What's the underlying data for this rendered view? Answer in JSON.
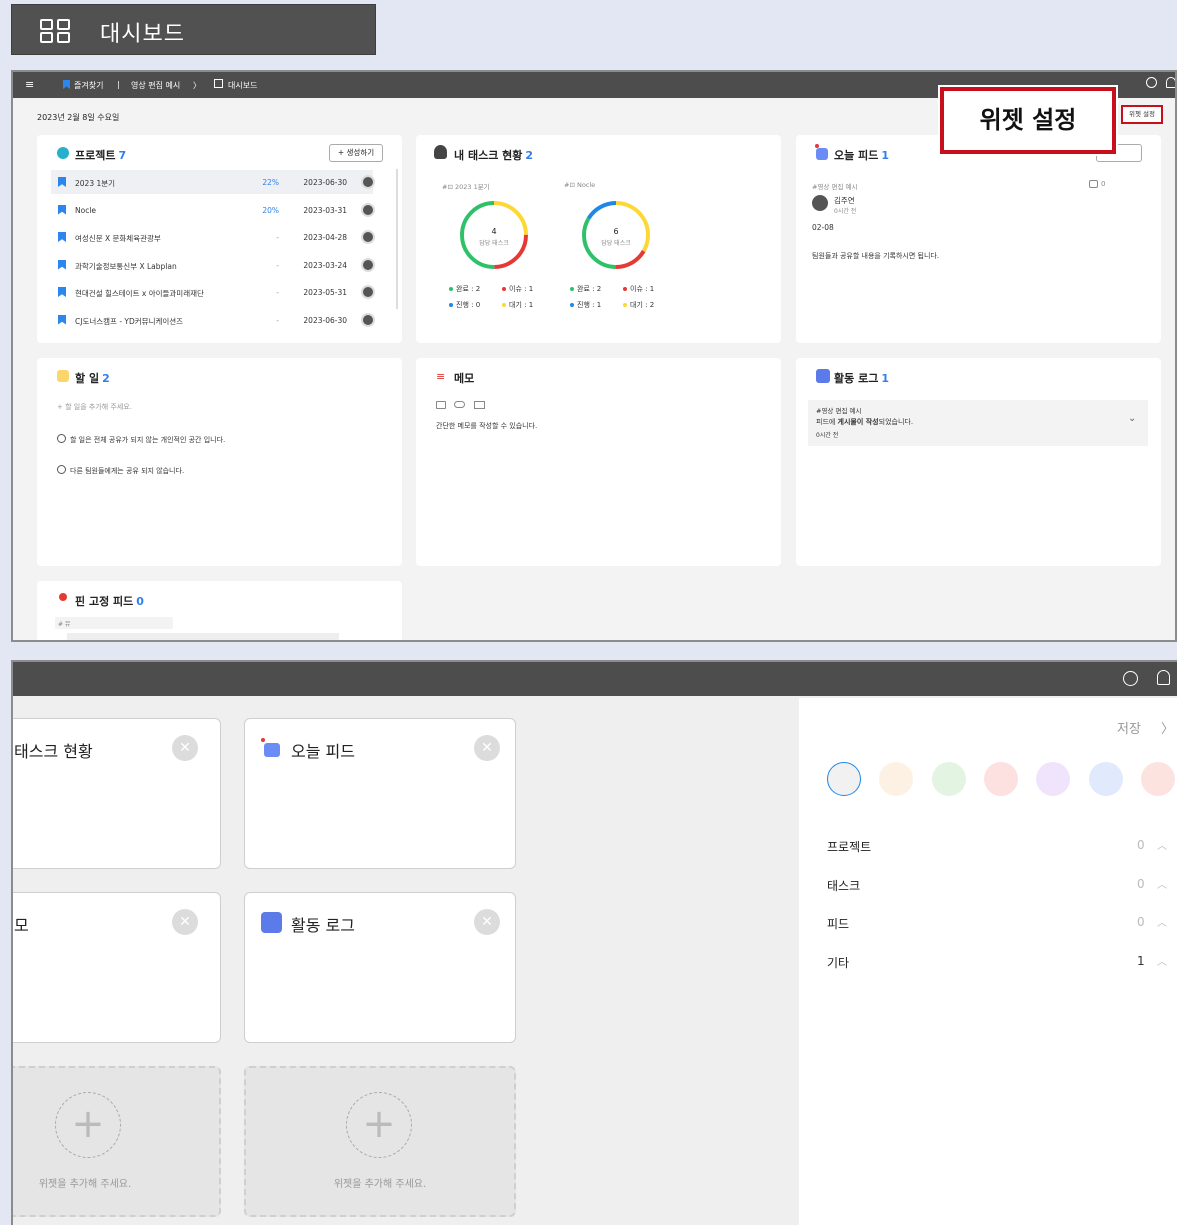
{
  "header": {
    "title": "대시보드",
    "icon": "dashboard-grid-icon"
  },
  "shot1": {
    "nav": {
      "favorites": "즐겨찾기",
      "divider": "|",
      "project": "영상 편집 예시",
      "arrow": "〉",
      "page": "대시보드"
    },
    "date": "2023년 2월 8일 수요일",
    "widget_settings_btn": "위젯 설정",
    "projects": {
      "title": "프로젝트",
      "count": "7",
      "create_btn": "+ 생성하기",
      "rows": [
        {
          "name": "2023 1분기",
          "pct": "22%",
          "date": "2023-06-30"
        },
        {
          "name": "Nocle",
          "pct": "20%",
          "date": "2023-03-31"
        },
        {
          "name": "여성신문 X 문화체육관광부",
          "pct": "-",
          "date": "2023-04-28"
        },
        {
          "name": "과학기술정보통신부 X Labplan",
          "pct": "-",
          "date": "2023-03-24"
        },
        {
          "name": "현대건설 힐스테이트 x 아이들과미래재단",
          "pct": "-",
          "date": "2023-05-31"
        },
        {
          "name": "CJ도너스캠프 - YD커뮤니케이션즈",
          "pct": "-",
          "date": "2023-06-30"
        }
      ]
    },
    "tasks": {
      "title": "내 태스크 현황",
      "count": "2",
      "charts": [
        {
          "tag": "#⊡ 2023 1분기",
          "num": "4",
          "label": "담당 태스크",
          "done": "완료 : 2",
          "issue": "이슈 : 1",
          "prog": "진행 : 0",
          "wait": "대기 : 1"
        },
        {
          "tag": "#⊡ Nocle",
          "num": "6",
          "label": "담당 태스크",
          "done": "완료 : 2",
          "issue": "이슈 : 1",
          "prog": "진행 : 1",
          "wait": "대기 : 2"
        }
      ]
    },
    "feed": {
      "title": "오늘 피드",
      "count": "1",
      "tag": "#영상 편집 예시",
      "user": "김주연",
      "time": "0시간 전",
      "date": "02-08",
      "img_count": "0",
      "body": "팀원들과 공유할 내용을 기록하시면 됩니다."
    },
    "todo": {
      "title": "할 일",
      "count": "2",
      "placeholder": "+ 할 일을 추가해 주세요.",
      "items": [
        "할 일은 전체 공유가 되지 않는 개인적인 공간 입니다.",
        "다른 팀원들에게는 공유 되지 않습니다."
      ]
    },
    "memo": {
      "title": "메모",
      "body": "간단한 메모를 작성할 수 있습니다."
    },
    "activity": {
      "title": "활동 로그",
      "count": "1",
      "tag": "#영상 편집 예시",
      "msg_pre": "피드에 ",
      "msg_b1": "게시물이 작성",
      "msg_post": "되었습니다.",
      "time": "0시간 전"
    },
    "pinned": {
      "title": "핀 고정 피드",
      "count": "0",
      "tag": "# 뮤"
    }
  },
  "callout": "위젯 설정",
  "shot2": {
    "cards": [
      "태스크 현황",
      "오늘 피드",
      "모",
      "활동 로그"
    ],
    "add_text": "위젯을 추가해 주세요.",
    "panel": {
      "save": "저장",
      "arrow": "〉",
      "colors": [
        "#f1f1f1",
        "#fdf1e4",
        "#e3f4e3",
        "#fde0e0",
        "#efe4fb",
        "#e0eafc",
        "#fde3e0"
      ],
      "categories": [
        {
          "name": "프로젝트",
          "count": "0"
        },
        {
          "name": "태스크",
          "count": "0"
        },
        {
          "name": "피드",
          "count": "0"
        },
        {
          "name": "기타",
          "count": "1"
        }
      ]
    }
  }
}
